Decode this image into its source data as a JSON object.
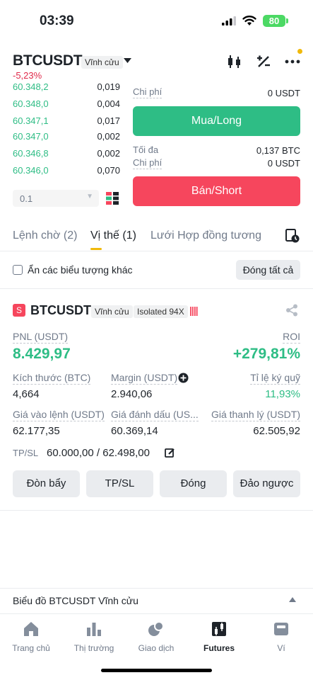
{
  "status_bar": {
    "time": "03:39",
    "battery": "80"
  },
  "header": {
    "pair": "BTCUSDT",
    "contract_type": "Vĩnh cửu",
    "change": "-5,23%"
  },
  "order_book": {
    "rows": [
      {
        "price": "60.348,2",
        "qty": "0,019"
      },
      {
        "price": "60.348,0",
        "qty": "0,004"
      },
      {
        "price": "60.347,1",
        "qty": "0,017"
      },
      {
        "price": "60.347,0",
        "qty": "0,002"
      },
      {
        "price": "60.346,8",
        "qty": "0,002"
      },
      {
        "price": "60.346,0",
        "qty": "0,070"
      }
    ],
    "quantity_step": "0.1"
  },
  "order_panel": {
    "cost_label": "Chi phí",
    "cost_value_top": "0 USDT",
    "buy_label": "Mua/Long",
    "max_label": "Tối đa",
    "max_value": "0,137 BTC",
    "cost_value_bottom": "0 USDT",
    "sell_label": "Bán/Short"
  },
  "tabs": [
    {
      "label": "Lệnh chờ (2)"
    },
    {
      "label": "Vị thế (1)"
    },
    {
      "label": "Lưới Hợp đồng tương"
    }
  ],
  "filter": {
    "hide_label": "Ẩn các biểu tượng khác",
    "close_all_label": "Đóng tất cả"
  },
  "position": {
    "side_badge": "S",
    "pair": "BTCUSDT",
    "contract_type": "Vĩnh cửu",
    "margin_mode": "Isolated 94X",
    "pnl_label": "PNL (USDT)",
    "pnl_value": "8.429,97",
    "roi_label": "ROI",
    "roi_value": "+279,81%",
    "size_label": "Kích thước (BTC)",
    "size_value": "4,664",
    "margin_label": "Margin (USDT)",
    "margin_value": "2.940,06",
    "margin_ratio_label": "Tỉ lệ ký quỹ",
    "margin_ratio_value": "11,93%",
    "entry_label": "Giá vào lệnh (USDT)",
    "entry_value": "62.177,35",
    "mark_label": "Giá đánh dấu (US...",
    "mark_value": "60.369,14",
    "liq_label": "Giá thanh lý (USDT)",
    "liq_value": "62.505,92",
    "tpsl_label": "TP/SL",
    "tpsl_value": "60.000,00 / 62.498,00",
    "actions": [
      "Đòn bẩy",
      "TP/SL",
      "Đóng",
      "Đảo ngược"
    ]
  },
  "chart_section": {
    "label": "Biểu đồ BTCUSDT Vĩnh cửu"
  },
  "bottom_nav": [
    {
      "label": "Trang chủ",
      "icon": "home-icon"
    },
    {
      "label": "Thị trường",
      "icon": "market-icon"
    },
    {
      "label": "Giao dịch",
      "icon": "trade-icon"
    },
    {
      "label": "Futures",
      "icon": "futures-icon"
    },
    {
      "label": "Ví",
      "icon": "wallet-icon"
    }
  ]
}
